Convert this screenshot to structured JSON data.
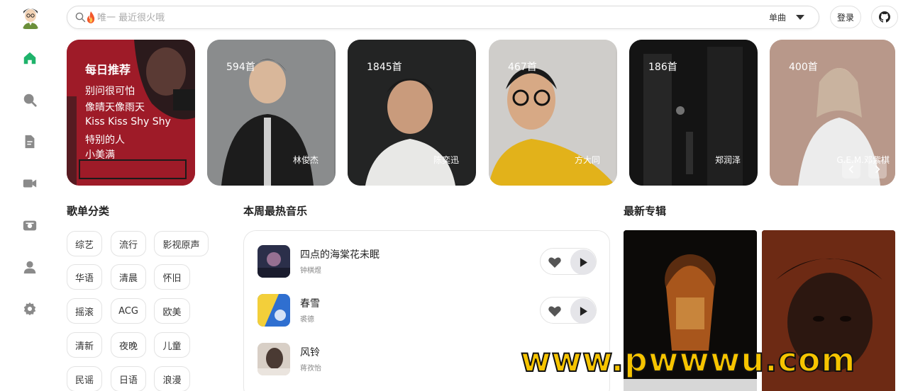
{
  "search": {
    "placeholder": "唯一 最近很火哦",
    "type_label": "单曲"
  },
  "header": {
    "login_label": "登录"
  },
  "daily": {
    "title": "每日推荐",
    "songs": [
      "别问很可怕",
      "像晴天像雨天",
      "Kiss Kiss Shy Shy",
      "特别的人",
      "小美满"
    ]
  },
  "artists": [
    {
      "count": "594首",
      "name": "林俊杰"
    },
    {
      "count": "1845首",
      "name": "陈奕迅"
    },
    {
      "count": "467首",
      "name": "方大同"
    },
    {
      "count": "186首",
      "name": "郑润泽"
    },
    {
      "count": "400首",
      "name": "G.E.M.邓紫棋"
    }
  ],
  "sections": {
    "categories": "歌单分类",
    "weekly_hot": "本周最热音乐",
    "new_albums": "最新专辑"
  },
  "tags": [
    "综艺",
    "流行",
    "影视原声",
    "华语",
    "清晨",
    "怀旧",
    "摇滚",
    "ACG",
    "欧美",
    "清新",
    "夜晚",
    "儿童",
    "民谣",
    "日语",
    "浪漫"
  ],
  "hot_songs": [
    {
      "title": "四点的海棠花未眠",
      "artist": "钟棋煜"
    },
    {
      "title": "春雪",
      "artist": "裘德"
    },
    {
      "title": "风铃",
      "artist": "蒋孜怡"
    }
  ],
  "watermark": "www.pwwwu.com",
  "colors": {
    "accent_green": "#1fb36b",
    "icon_gray": "#8a8a8a",
    "daily_red": "#a71d2a",
    "watermark_yellow": "#f6c400"
  },
  "icons": {
    "sidebar": [
      "home-icon",
      "search-icon",
      "document-icon",
      "video-icon",
      "radio-icon",
      "user-icon",
      "settings-icon"
    ]
  }
}
